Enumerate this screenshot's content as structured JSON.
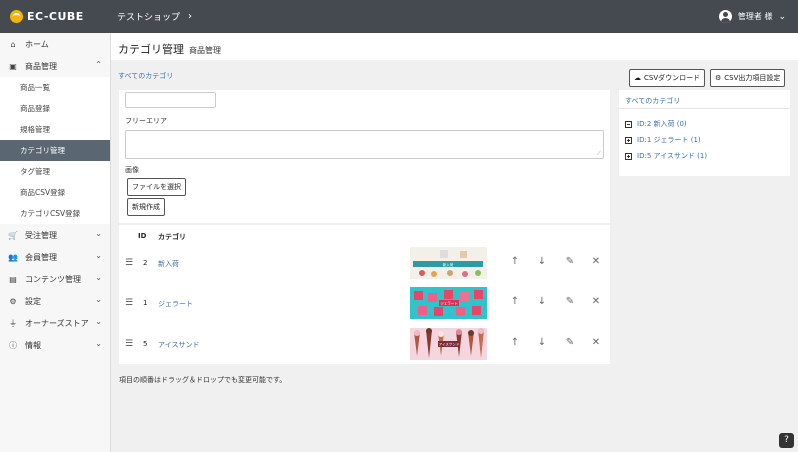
{
  "header": {
    "logo_text": "EC-CUBE",
    "shop_name": "テストショップ",
    "user_name": "管理者 様"
  },
  "sidebar": {
    "items": [
      {
        "label": "ホーム",
        "icon": "home-icon"
      },
      {
        "label": "商品管理",
        "icon": "cube-icon",
        "expanded": true
      },
      {
        "label": "受注管理",
        "icon": "cart-icon"
      },
      {
        "label": "会員管理",
        "icon": "users-icon"
      },
      {
        "label": "コンテンツ管理",
        "icon": "file-icon"
      },
      {
        "label": "設定",
        "icon": "gear-icon"
      },
      {
        "label": "オーナーズストア",
        "icon": "plug-icon"
      },
      {
        "label": "情報",
        "icon": "info-icon"
      }
    ],
    "subitems": [
      "商品一覧",
      "商品登録",
      "規格管理",
      "カテゴリ管理",
      "タグ管理",
      "商品CSV登録",
      "カテゴリCSV登録"
    ]
  },
  "page": {
    "title": "カテゴリ管理",
    "subtitle": "商品管理",
    "breadcrumb": "すべてのカテゴリ"
  },
  "form": {
    "free_area_label": "フリーエリア",
    "image_label": "画像",
    "file_button": "ファイルを選択",
    "create_button": "新規作成"
  },
  "table": {
    "headers": {
      "id": "ID",
      "category": "カテゴリ"
    },
    "rows": [
      {
        "id": "2",
        "name": "新入荷",
        "image": "新入荷"
      },
      {
        "id": "1",
        "name": "ジェラート",
        "image": "ジェラート"
      },
      {
        "id": "5",
        "name": "アイスサンド",
        "image": "アイスサンド"
      }
    ]
  },
  "note": "項目の順番はドラッグ＆ドロップでも変更可能です。",
  "right": {
    "csv_download": "CSVダウンロード",
    "csv_settings": "CSV出力項目設定",
    "tree_header": "すべてのカテゴリ",
    "tree": [
      "ID:2 新入荷 (0)",
      "ID:1 ジェラート (1)",
      "ID:5 アイスサンド (1)"
    ]
  },
  "colors": {
    "header_bg": "#454a51",
    "sidebar_active": "#5b6673",
    "link": "#3a6ea5",
    "logo_accent": "#f2b705"
  }
}
